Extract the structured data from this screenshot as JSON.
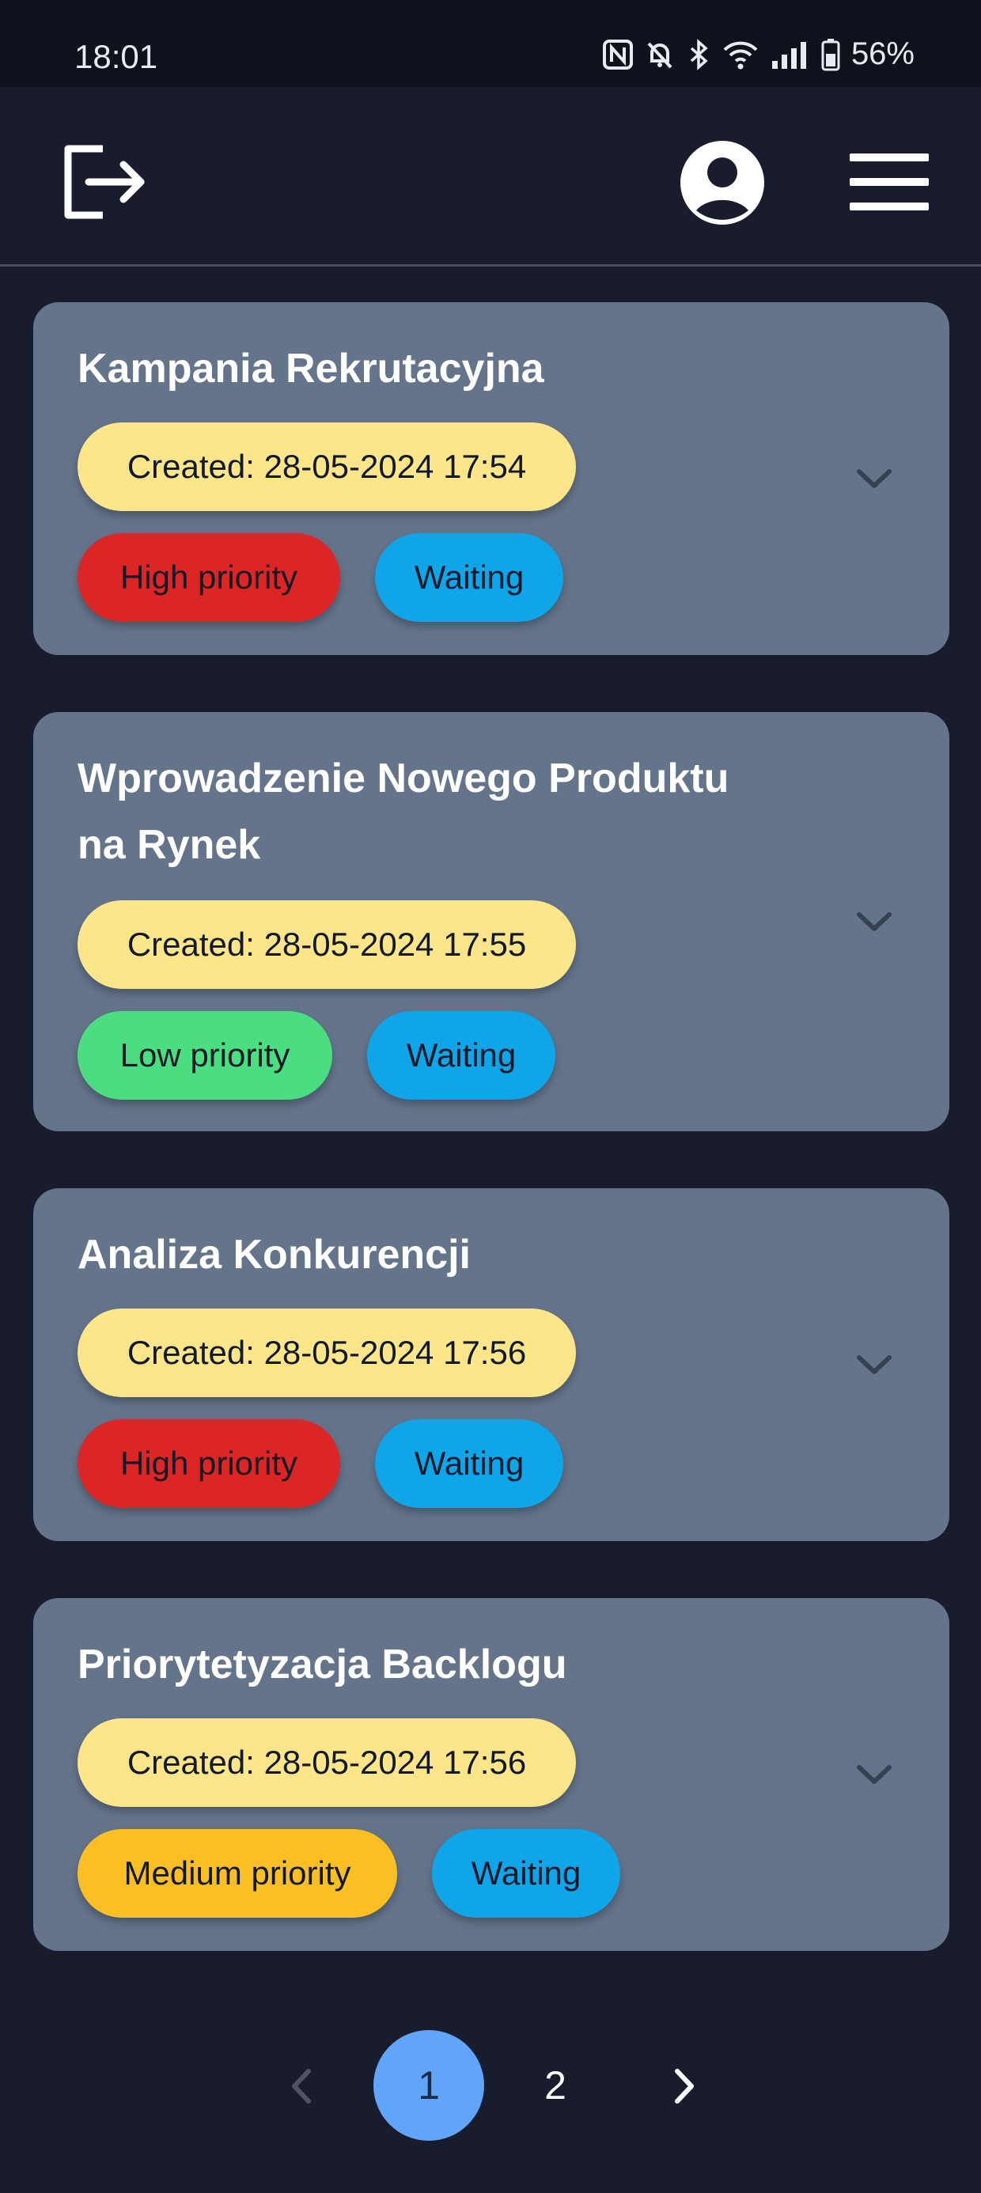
{
  "status_bar": {
    "time": "18:01",
    "battery": "56%"
  },
  "app_bar": {
    "icons": [
      "logout-icon",
      "user-avatar-icon",
      "hamburger-menu-icon"
    ]
  },
  "tasks": [
    {
      "title_lines": [
        "Kampania Rekrutacyjna"
      ],
      "created": "Created: 28-05-2024 17:54",
      "priority": "High priority",
      "priority_color": "#dc2626",
      "status": "Waiting"
    },
    {
      "title_lines": [
        "Wprowadzenie Nowego Produktu",
        "na Rynek"
      ],
      "created": "Created: 28-05-2024 17:55",
      "priority": "Low priority",
      "priority_color": "#4ade80",
      "status": "Waiting"
    },
    {
      "title_lines": [
        "Analiza Konkurencji"
      ],
      "created": "Created: 28-05-2024 17:56",
      "priority": "High priority",
      "priority_color": "#dc2626",
      "status": "Waiting"
    },
    {
      "title_lines": [
        "Priorytetyzacja Backlogu"
      ],
      "created": "Created: 28-05-2024 17:56",
      "priority": "Medium priority",
      "priority_color": "#fbbf24",
      "status": "Waiting"
    }
  ],
  "pagination": {
    "pages": [
      "1",
      "2"
    ],
    "current_page": "1"
  },
  "colors": {
    "background": "#181c2c",
    "card": "#64748b",
    "created_pill": "#fde68a",
    "waiting_pill": "#0ea5e9",
    "active_page": "#60a5fa"
  }
}
